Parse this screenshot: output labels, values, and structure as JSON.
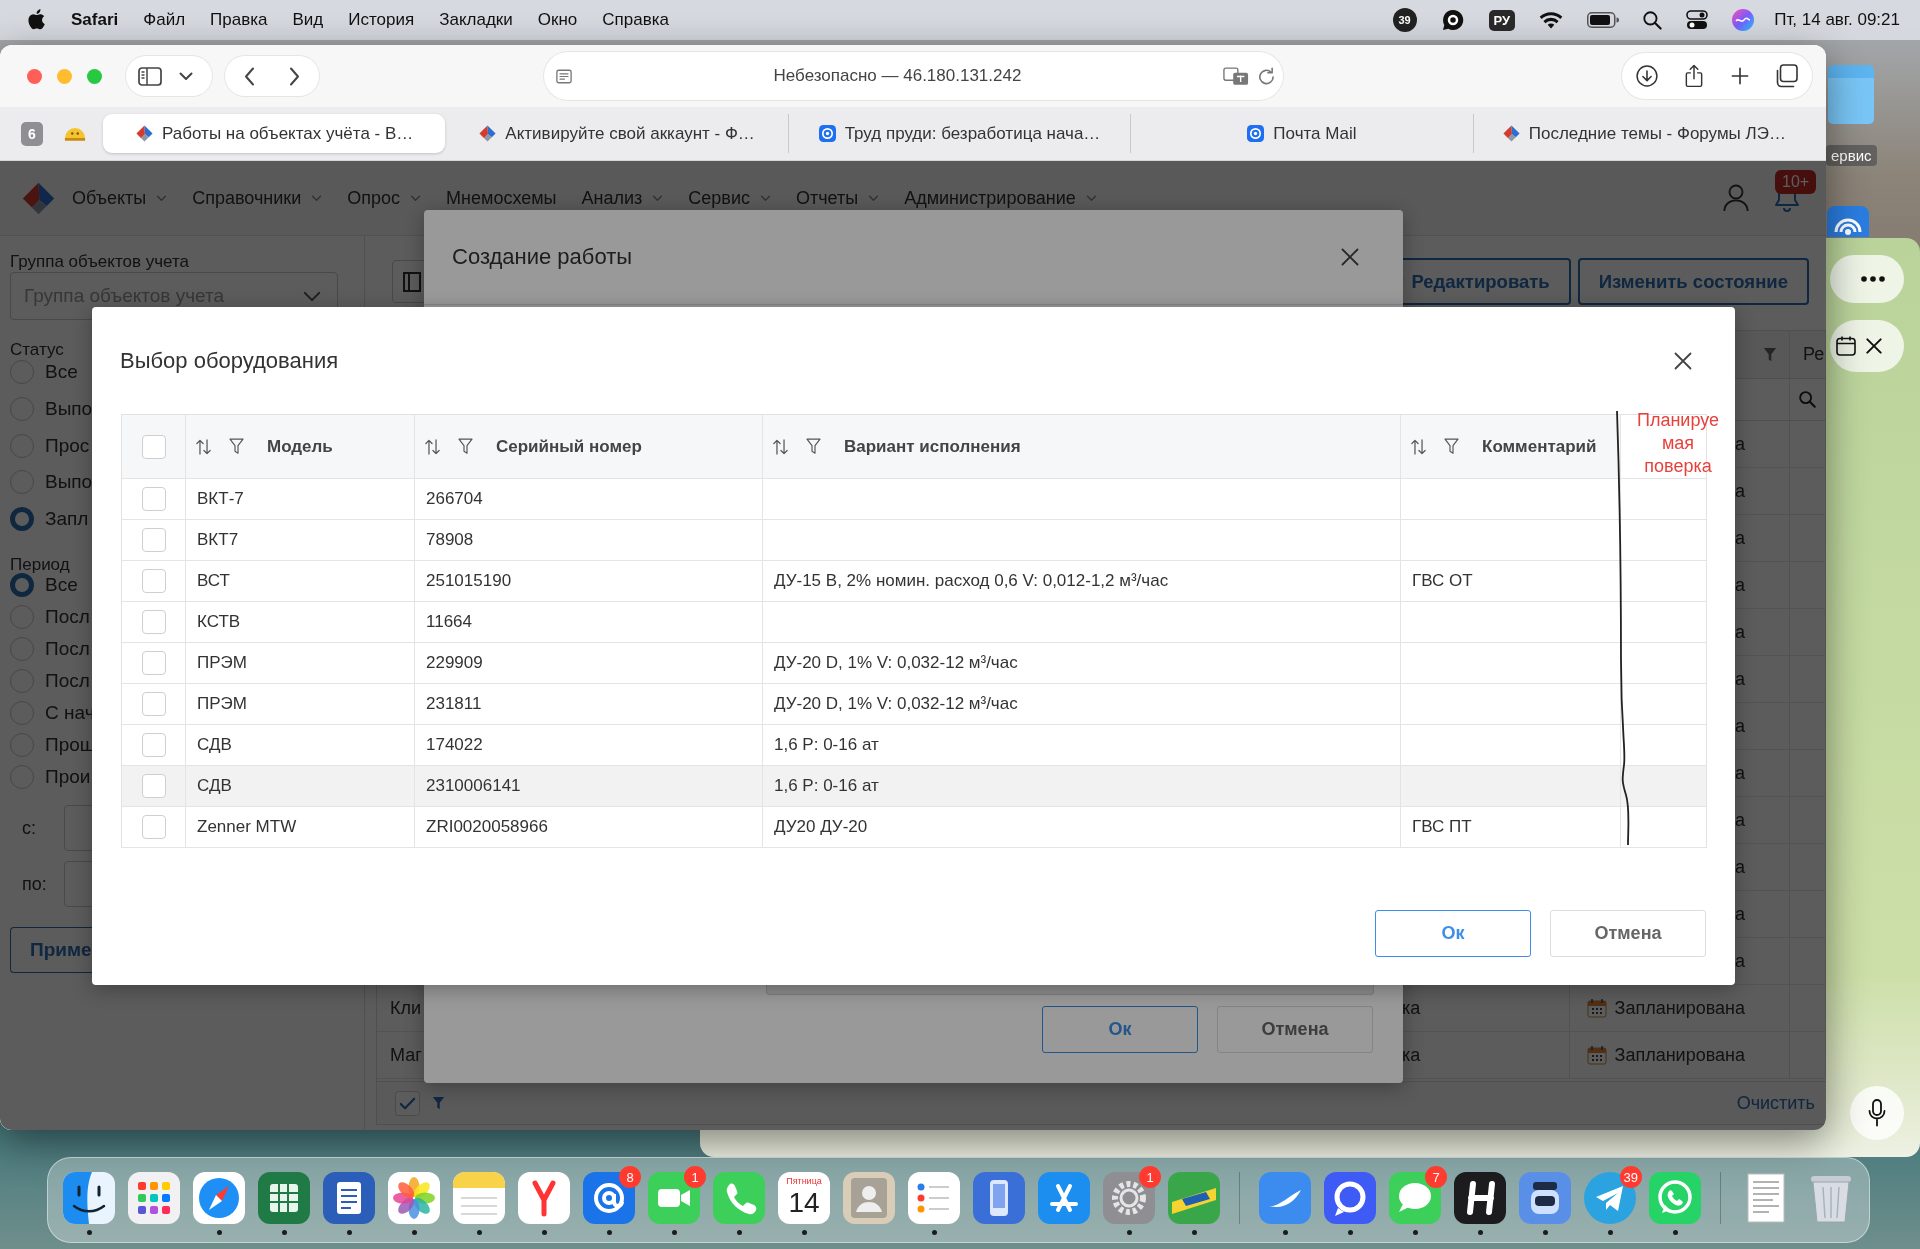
{
  "menu_bar": {
    "app_name": "Safari",
    "menus": [
      "Файл",
      "Правка",
      "Вид",
      "История",
      "Закладки",
      "Окно",
      "Справка"
    ],
    "status_badge": "39",
    "input_source": "РУ",
    "clock": "Пт, 14 авг. 09:21"
  },
  "desktop": {
    "folder_label": "ервис"
  },
  "browser": {
    "address": "Небезопасно — 46.180.131.242",
    "tab_count": "6",
    "tabs": [
      {
        "kind": "site",
        "title": "Работы на объектах учёта - В…",
        "selected": true
      },
      {
        "kind": "site",
        "title": "Активируйте свой аккаунт - Ф…",
        "selected": false
      },
      {
        "kind": "mail",
        "title": "Труд пруди: безработица нача…",
        "selected": false
      },
      {
        "kind": "mail",
        "title": "Почта Mail",
        "selected": false
      },
      {
        "kind": "site",
        "title": "Последние темы - Форумы ЛЭ…",
        "selected": false
      }
    ]
  },
  "app": {
    "menu": [
      {
        "label": "Объекты",
        "dropdown": true
      },
      {
        "label": "Справочники",
        "dropdown": true
      },
      {
        "label": "Опрос",
        "dropdown": true
      },
      {
        "label": "Мнемосхемы",
        "dropdown": false
      },
      {
        "label": "Анализ",
        "dropdown": true
      },
      {
        "label": "Сервис",
        "dropdown": true
      },
      {
        "label": "Отчеты",
        "dropdown": true
      },
      {
        "label": "Администрирование",
        "dropdown": true
      }
    ],
    "notification_count": "10+",
    "filters": {
      "group_label": "Группа объектов учета",
      "group_placeholder": "Группа объектов учета",
      "status_label": "Статус",
      "status_options": [
        {
          "label": "Все",
          "selected": false
        },
        {
          "label": "Выпо",
          "selected": false
        },
        {
          "label": "Прос",
          "selected": false
        },
        {
          "label": "Выпо",
          "selected": false
        },
        {
          "label": "Запл",
          "selected": true
        }
      ],
      "period_label": "Период",
      "period_options": [
        {
          "label": "Все",
          "selected": true
        },
        {
          "label": "Посл",
          "selected": false
        },
        {
          "label": "Посл",
          "selected": false
        },
        {
          "label": "Посл",
          "selected": false
        },
        {
          "label": "С нач",
          "selected": false
        },
        {
          "label": "Прош",
          "selected": false
        },
        {
          "label": "Прои",
          "selected": false
        }
      ],
      "from_label": "с:",
      "to_label": "по:",
      "apply_button": "Приме"
    },
    "actions": [
      {
        "kind": "icon",
        "label": "Редактировать"
      },
      {
        "kind": "text",
        "label": "Изменить состояние"
      }
    ],
    "table": {
      "column_4": "Ре",
      "rows": [
        {
          "kind": "covered",
          "status": "а"
        },
        {
          "kind": "covered",
          "status": "а"
        },
        {
          "kind": "covered",
          "status": "а"
        },
        {
          "kind": "covered",
          "status": "а"
        },
        {
          "kind": "covered",
          "status": "а"
        },
        {
          "kind": "covered",
          "status": "а"
        },
        {
          "kind": "covered",
          "status": "а"
        },
        {
          "kind": "covered",
          "status": "а"
        },
        {
          "kind": "covered",
          "status": "а"
        },
        {
          "kind": "covered",
          "status": "а"
        },
        {
          "kind": "covered",
          "status": "а"
        },
        {
          "kind": "covered",
          "status": "а"
        },
        {
          "kind": "full",
          "column_1": "Кли",
          "column_2": "ка",
          "status": "Запланирована"
        },
        {
          "kind": "full",
          "column_1": "Маг",
          "column_2": "ка",
          "status": "Запланирована"
        }
      ],
      "footer_link": "Очистить"
    }
  },
  "work_dialog": {
    "title": "Создание работы",
    "buttons": [
      {
        "kind": "primary",
        "label": "Ок"
      },
      {
        "kind": "secondary",
        "label": "Отмена"
      }
    ]
  },
  "equipment_dialog": {
    "title": "Выбор оборудования",
    "all_checked": false,
    "columns": [
      "Модель",
      "Серийный номер",
      "Вариант исполнения",
      "Комментарий"
    ],
    "rows": [
      {
        "model": "ВКТ-7",
        "serial": "266704",
        "checked": false,
        "highlighted": false
      },
      {
        "model": "ВКТ7",
        "serial": "78908",
        "checked": false,
        "highlighted": false
      },
      {
        "model": "ВСТ",
        "serial": "251015190",
        "variant": "ДУ-15 В, 2% номин. расход 0,6 V: 0,012-1,2 м³/час",
        "comment": "ГВС ОТ",
        "checked": false,
        "highlighted": false
      },
      {
        "model": "КСТВ",
        "serial": "11664",
        "checked": false,
        "highlighted": false
      },
      {
        "model": "ПРЭМ",
        "serial": "229909",
        "variant": "ДУ-20 D, 1% V: 0,032-12 м³/час",
        "checked": false,
        "highlighted": false
      },
      {
        "model": "ПРЭМ",
        "serial": "231811",
        "variant": "ДУ-20 D, 1% V: 0,032-12 м³/час",
        "checked": false,
        "highlighted": false
      },
      {
        "model": "СДВ",
        "serial": "174022",
        "variant": "1,6 P: 0-16 ат",
        "checked": false,
        "highlighted": false
      },
      {
        "model": "СДВ",
        "serial": "2310006141",
        "variant": "1,6 P: 0-16 ат",
        "checked": false,
        "highlighted": true
      },
      {
        "model": "Zenner MTW",
        "serial": "ZRI0020058966",
        "variant": "ДУ20 ДУ-20",
        "comment": "ГВС ПТ",
        "checked": false,
        "highlighted": false
      }
    ],
    "buttons": [
      {
        "kind": "primary",
        "label": "Ок"
      },
      {
        "kind": "secondary",
        "label": "Отмена"
      }
    ],
    "annotation": {
      "lines": [
        "Планируе",
        "мая",
        "поверка"
      ]
    }
  },
  "dock": {
    "apps": [
      {
        "kind": "face",
        "running": true
      },
      {
        "kind": "grid",
        "running": false
      },
      {
        "kind": "compass",
        "running": true
      },
      {
        "kind": "spreadsheet",
        "running": true
      },
      {
        "kind": "doclines",
        "running": true
      },
      {
        "kind": "flower",
        "running": true
      },
      {
        "kind": "notes",
        "running": true
      },
      {
        "kind": "fork",
        "running": true
      },
      {
        "kind": "at_sign",
        "badge": "8",
        "running": true
      },
      {
        "kind": "video",
        "badge": "1",
        "running": true
      },
      {
        "kind": "phone",
        "running": true
      },
      {
        "kind": "calendar",
        "weekday": "Пятница",
        "day": "14",
        "running": true
      },
      {
        "kind": "contacts",
        "running": false
      },
      {
        "kind": "checklist",
        "running": true
      },
      {
        "kind": "device",
        "running": false
      },
      {
        "kind": "sticks",
        "running": false
      },
      {
        "kind": "gear",
        "badge": "1",
        "running": true
      },
      {
        "kind": "stripes",
        "running": true
      }
    ],
    "recent": [
      {
        "kind": "swoosh",
        "running": true
      },
      {
        "kind": "ring_chat",
        "running": true
      },
      {
        "kind": "bubble",
        "badge": "7",
        "running": true
      },
      {
        "kind": "bars",
        "running": true
      },
      {
        "kind": "jar",
        "running": true
      },
      {
        "kind": "plane",
        "badge": "39",
        "running": true
      },
      {
        "kind": "phone_bubble",
        "running": true
      }
    ],
    "stack": [
      {
        "kind": "paper",
        "running": false
      },
      {
        "kind": "trash",
        "running": false
      }
    ]
  }
}
